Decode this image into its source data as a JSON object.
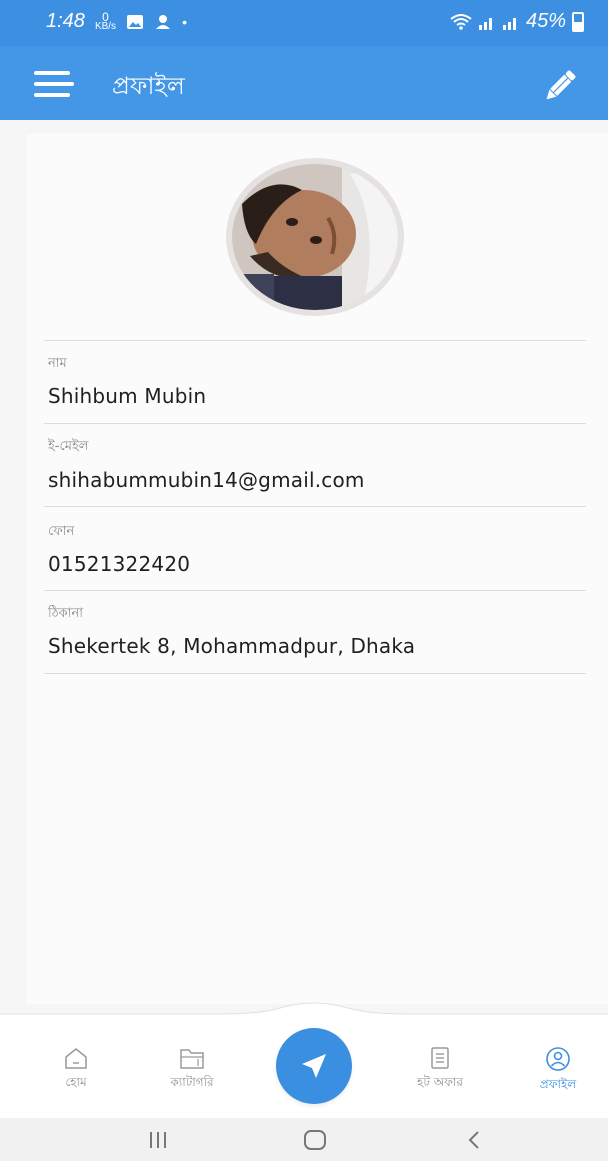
{
  "status_bar": {
    "time": "1:48",
    "net_speed_value": "0",
    "net_speed_unit": "KB/s",
    "dot": "•",
    "battery_text": "45%"
  },
  "app_bar": {
    "title": "প্রফাইল"
  },
  "profile": {
    "fields": [
      {
        "label": "নাম",
        "value": "Shihbum Mubin"
      },
      {
        "label": "ই-মেইল",
        "value": "shihabummubin14@gmail.com"
      },
      {
        "label": "ফোন",
        "value": "01521322420"
      },
      {
        "label": "ঠিকানা",
        "value": "Shekertek 8, Mohammadpur, Dhaka"
      }
    ]
  },
  "bottom_nav": {
    "items": [
      {
        "label": "হোম",
        "icon": "home-icon"
      },
      {
        "label": "ক্যাটাগরি",
        "icon": "folder-icon"
      },
      {
        "label": "হট অফার",
        "icon": "list-icon"
      },
      {
        "label": "প্রফাইল",
        "icon": "profile-icon",
        "active": true
      }
    ],
    "fab_icon": "send-icon"
  },
  "colors": {
    "primary": "#4496e7",
    "status_bar": "#3d8fe2",
    "fab": "#3a8fe0"
  }
}
